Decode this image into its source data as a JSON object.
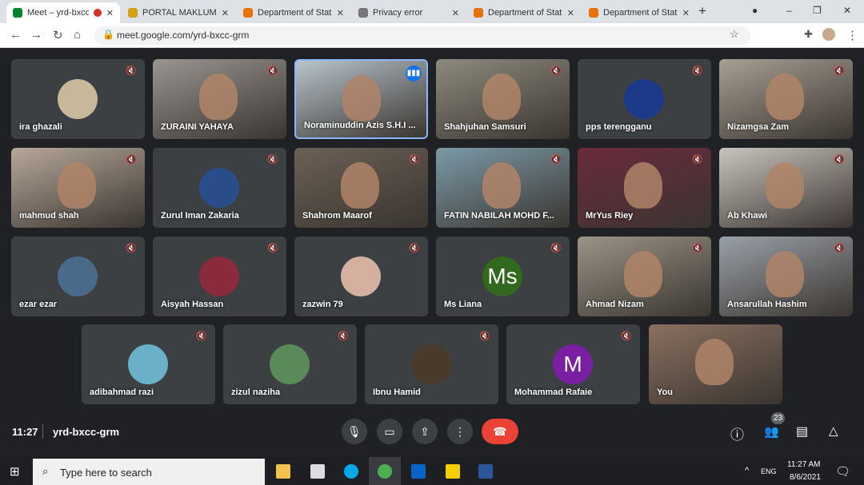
{
  "browser": {
    "tabs": [
      {
        "title": "Meet – yrd-bxcc",
        "color": "#00832d",
        "active": true,
        "recording": true
      },
      {
        "title": "PORTAL MAKLUMAT",
        "color": "#d4a017"
      },
      {
        "title": "Department of Stati",
        "color": "#e8710a"
      },
      {
        "title": "Privacy error",
        "color": "#777"
      },
      {
        "title": "Department of Stati",
        "color": "#e8710a"
      },
      {
        "title": "Department of Stati",
        "color": "#e8710a"
      }
    ],
    "new_tab": "+",
    "url": "meet.google.com/yrd-bxcc-grm"
  },
  "participants": [
    {
      "name": "ira ghazali",
      "type": "avatar",
      "color": "#c9b79c"
    },
    {
      "name": "ZURAINI YAHAYA",
      "type": "video",
      "color": "#9a9590"
    },
    {
      "name": "Noraminuddin Azis S.H.I ...",
      "type": "video",
      "color": "#b8c4cc",
      "speaking": true
    },
    {
      "name": "Shahjuhan Samsuri",
      "type": "video",
      "color": "#8e8a7e"
    },
    {
      "name": "pps terengganu",
      "type": "avatar",
      "color": "#1d3a8a"
    },
    {
      "name": "Nizamgsa Zam",
      "type": "video",
      "color": "#a89f94"
    },
    {
      "name": "mahmud shah",
      "type": "video",
      "color": "#b7a99a"
    },
    {
      "name": "Zurul Iman Zakaria",
      "type": "avatar",
      "color": "#2a4d8a"
    },
    {
      "name": "Shahrom Maarof",
      "type": "video",
      "color": "#6b6055"
    },
    {
      "name": "FATIN NABILAH MOHD F...",
      "type": "video",
      "color": "#7c9aa8"
    },
    {
      "name": "MrYus Riey",
      "type": "video",
      "color": "#6a2a3c"
    },
    {
      "name": "Ab Khawi",
      "type": "video",
      "color": "#c8c4be"
    },
    {
      "name": "ezar ezar",
      "type": "avatar",
      "color": "#4a6a8a"
    },
    {
      "name": "Aisyah Hassan",
      "type": "avatar",
      "color": "#8a2a3a"
    },
    {
      "name": "zazwin 79",
      "type": "avatar",
      "color": "#d4b0a0"
    },
    {
      "name": "Ms Liana",
      "type": "letter",
      "letter": "Ms",
      "color": "#33691e"
    },
    {
      "name": "Ahmad Nizam",
      "type": "video",
      "color": "#9a9486"
    },
    {
      "name": "Ansarullah Hashim",
      "type": "video",
      "color": "#9aa0a8"
    },
    {
      "name": "adibahmad razi",
      "type": "avatar",
      "color": "#6ab0c8"
    },
    {
      "name": "zizul naziha",
      "type": "avatar",
      "color": "#5a8a5a"
    },
    {
      "name": "Ibnu Hamid",
      "type": "avatar",
      "color": "#4a3a2a"
    },
    {
      "name": "Mohammad Rafaie",
      "type": "letter",
      "letter": "M",
      "color": "#7b1fa2"
    },
    {
      "name": "You",
      "type": "video",
      "color": "#8a7060",
      "self": true
    }
  ],
  "meeting": {
    "time": "11:27",
    "code": "yrd-bxcc-grm",
    "participant_count": "23"
  },
  "taskbar": {
    "search_placeholder": "Type here to search",
    "lang": "ENG",
    "time": "11:27 AM",
    "date": "8/6/2021"
  }
}
